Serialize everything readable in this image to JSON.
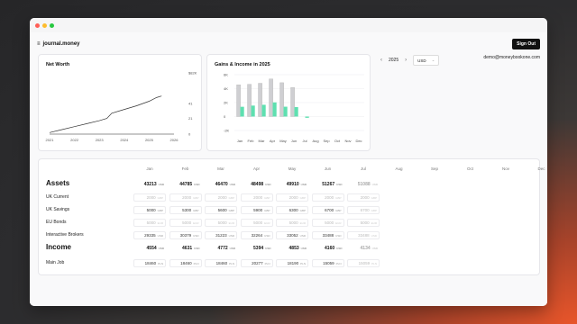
{
  "app": {
    "name": "journal.money"
  },
  "header": {
    "signout_label": "Sign Out"
  },
  "user": {
    "email": "demo@moneybookone.com"
  },
  "controls": {
    "year": "2025",
    "prev": "‹",
    "next": "›",
    "currency": "USD"
  },
  "colors": {
    "accent": "#5ee0b0",
    "gray_bar": "#cfcfd2",
    "line": "#333333"
  },
  "net_worth": {
    "title": "Net Worth",
    "y_ticks": [
      "$82K",
      "41",
      "21",
      "0"
    ],
    "x_ticks": [
      "2021",
      "2022",
      "2023",
      "2024",
      "2025",
      "2026"
    ]
  },
  "gains": {
    "title": "Gains & Income in 2025",
    "y_ticks": [
      "6K",
      "4K",
      "2K",
      "0",
      "-2K"
    ],
    "x_ticks": [
      "Jan",
      "Feb",
      "Mar",
      "Apr",
      "May",
      "Jun",
      "Jul",
      "Aug",
      "Sep",
      "Oct",
      "Nov",
      "Dec"
    ]
  },
  "table": {
    "months": [
      "Jan",
      "Feb",
      "Mar",
      "Apr",
      "May",
      "Jun",
      "Jul",
      "Aug",
      "Sep",
      "Oct",
      "Nov",
      "Dec"
    ],
    "rows": [
      {
        "label": "Assets",
        "type": "section",
        "values": [
          "43213",
          "44785",
          "46470",
          "48498",
          "49910",
          "51267",
          "51088"
        ],
        "currency": [
          "USD",
          "USD",
          "USD",
          "USD",
          "USD",
          "USD",
          "USD"
        ]
      },
      {
        "label": "UK Current",
        "type": "item",
        "values": [
          "2000",
          "2000",
          "2000",
          "2000",
          "2000",
          "2000",
          "2000"
        ],
        "currency": [
          "GBP",
          "GBP",
          "GBP",
          "GBP",
          "GBP",
          "GBP",
          "GBP"
        ]
      },
      {
        "label": "UK Savings",
        "type": "item",
        "values": [
          "5000",
          "5300",
          "5600",
          "5900",
          "6300",
          "6700",
          "6700"
        ],
        "currency": [
          "GBP",
          "GBP",
          "GBP",
          "GBP",
          "GBP",
          "GBP",
          "GBP"
        ]
      },
      {
        "label": "EU Bonds",
        "type": "item",
        "values": [
          "5000",
          "5000",
          "5000",
          "5000",
          "5000",
          "5000",
          "5000"
        ],
        "currency": [
          "EUR",
          "EUR",
          "EUR",
          "EUR",
          "EUR",
          "EUR",
          "EUR"
        ]
      },
      {
        "label": "Interactive Brokers",
        "type": "item",
        "values": [
          "29335",
          "30379",
          "31223",
          "32264",
          "33052",
          "33488",
          "33488"
        ],
        "currency": [
          "USD",
          "USD",
          "USD",
          "USD",
          "USD",
          "USD",
          "USD"
        ]
      },
      {
        "label": "Income",
        "type": "section",
        "values": [
          "4554",
          "4631",
          "4772",
          "5394",
          "4853",
          "4160",
          "4134"
        ],
        "currency": [
          "USD",
          "USD",
          "USD",
          "USD",
          "USD",
          "USD",
          "USD"
        ]
      },
      {
        "label": "Main Job",
        "type": "item",
        "values": [
          "18460",
          "18460",
          "18460",
          "20277",
          "18190",
          "15059",
          "15059"
        ],
        "currency": [
          "PLN",
          "PLN",
          "PLN",
          "PLN",
          "PLN",
          "PLN",
          "PLN"
        ]
      }
    ]
  },
  "chart_data": [
    {
      "type": "line",
      "title": "Net Worth",
      "x": [
        "2021",
        "2021.5",
        "2022",
        "2022.5",
        "2023",
        "2023.3",
        "2023.5",
        "2024",
        "2024.5",
        "2025",
        "2025.3",
        "2025.5"
      ],
      "series": [
        {
          "values": [
            2,
            6,
            10,
            14,
            18,
            21,
            28,
            33,
            38,
            44,
            49,
            51
          ]
        }
      ],
      "ylim": [
        0,
        82
      ],
      "grid": false
    },
    {
      "type": "bar",
      "title": "Gains & Income in 2025",
      "categories": [
        "Jan",
        "Feb",
        "Mar",
        "Apr",
        "May",
        "Jun",
        "Jul",
        "Aug",
        "Sep",
        "Oct",
        "Nov",
        "Dec"
      ],
      "series": [
        {
          "values": [
            4554,
            4631,
            4772,
            5394,
            4853,
            4160,
            0,
            0,
            0,
            0,
            0,
            0
          ]
        },
        {
          "values": [
            1400,
            1572,
            1685,
            2028,
            1412,
            1357,
            -179,
            0,
            0,
            0,
            0,
            0
          ]
        }
      ],
      "ylim": [
        -2000,
        6000
      ],
      "grid": true
    }
  ]
}
